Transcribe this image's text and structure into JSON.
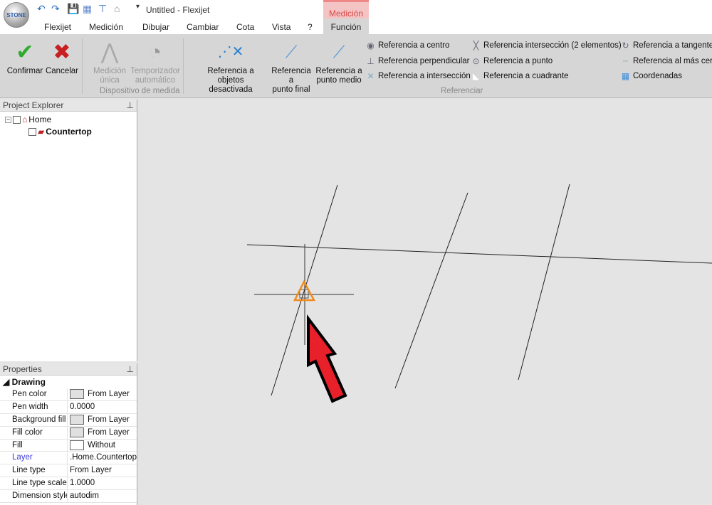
{
  "app": {
    "title": "Untitled - Flexijet",
    "logo_text": "STONE"
  },
  "context_tab": "Medición",
  "tabs": [
    "Flexijet",
    "Medición",
    "Dibujar",
    "Cambiar",
    "Cota",
    "Vista",
    "?",
    "Función"
  ],
  "ribbon": {
    "confirm": "Confirmar",
    "cancel": "Cancelar",
    "single_measure": "Medición única",
    "timer_1": "Temporizador",
    "timer_2": "automático",
    "group_device": "Dispositivo de medida",
    "snap_off_1": "Referencia a objetos",
    "snap_off_2": "desactivada",
    "endpoint_1": "Referencia a",
    "endpoint_2": "punto final",
    "midpoint_1": "Referencia a",
    "midpoint_2": "punto medio",
    "small": [
      "Referencia a centro",
      "Referencia perpendicular",
      "Referencia a intersección",
      "Referencia intersección (2 elementos)",
      "Referencia a punto",
      "Referencia a cuadrante",
      "Referencia a tangente",
      "Referencia al más cerca",
      "Coordenadas"
    ],
    "group_ref": "Referenciar"
  },
  "explorer": {
    "title": "Project Explorer",
    "pin": "📌",
    "items": [
      "Home",
      "Countertop"
    ]
  },
  "properties": {
    "title": "Properties",
    "section": "Drawing",
    "rows": [
      {
        "k": "Pen color",
        "v": "From Layer",
        "sw": "g"
      },
      {
        "k": "Pen width",
        "v": "0.0000"
      },
      {
        "k": "Background fill",
        "v": "From Layer",
        "sw": "g"
      },
      {
        "k": "Fill color",
        "v": "From Layer",
        "sw": "g"
      },
      {
        "k": "Fill",
        "v": "Without",
        "sw": "w"
      },
      {
        "k": "Layer",
        "v": ".Home.Countertop"
      },
      {
        "k": "Line type",
        "v": "From Layer"
      },
      {
        "k": "Line type scale f",
        "v": "1.0000"
      },
      {
        "k": "Dimension style",
        "v": "autodim"
      }
    ]
  },
  "colors": {
    "accent_ctx": "#d84848",
    "arrow": "#e8202a",
    "snap": "#f08a1c",
    "layer_link": "#3b3bd8"
  }
}
